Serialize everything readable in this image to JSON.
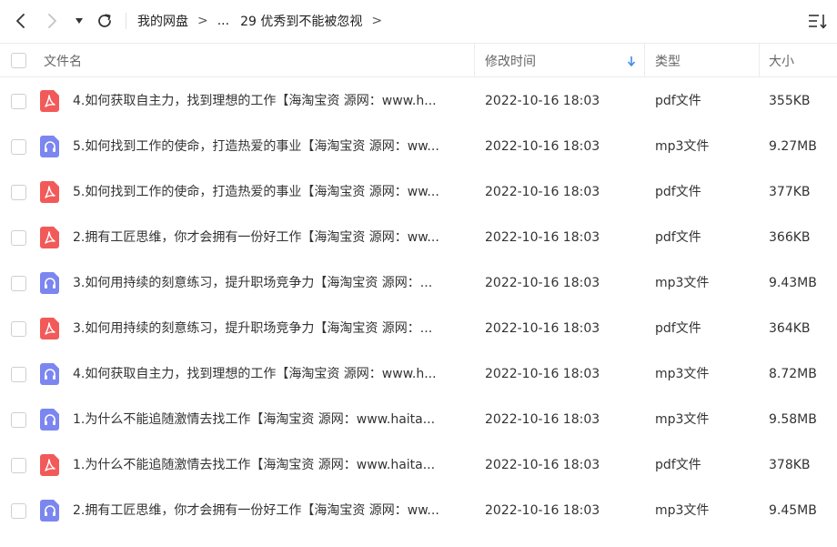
{
  "breadcrumb": {
    "root": "我的网盘",
    "ellipsis": "...",
    "current": "29 优秀到不能被忽视",
    "separator": ">"
  },
  "table": {
    "columns": {
      "name": "文件名",
      "modified": "修改时间",
      "type": "类型",
      "size": "大小"
    },
    "sorted_by": "修改时间",
    "sort_direction": "descending",
    "rows": [
      {
        "icon": "pdf-file-icon",
        "name": "4.如何获取自主力，找到理想的工作【海淘宝资 源网：www.h...",
        "modified": "2022-10-16 18:03",
        "type": "pdf文件",
        "size": "355KB"
      },
      {
        "icon": "mp3-file-icon",
        "name": "5.如何找到工作的使命，打造热爱的事业【海淘宝资 源网：ww...",
        "modified": "2022-10-16 18:03",
        "type": "mp3文件",
        "size": "9.27MB"
      },
      {
        "icon": "pdf-file-icon",
        "name": "5.如何找到工作的使命，打造热爱的事业【海淘宝资 源网：ww...",
        "modified": "2022-10-16 18:03",
        "type": "pdf文件",
        "size": "377KB"
      },
      {
        "icon": "pdf-file-icon",
        "name": "2.拥有工匠思维，你才会拥有一份好工作【海淘宝资 源网：ww...",
        "modified": "2022-10-16 18:03",
        "type": "pdf文件",
        "size": "366KB"
      },
      {
        "icon": "mp3-file-icon",
        "name": "3.如何用持续的刻意练习，提升职场竞争力【海淘宝资 源网：...",
        "modified": "2022-10-16 18:03",
        "type": "mp3文件",
        "size": "9.43MB"
      },
      {
        "icon": "pdf-file-icon",
        "name": "3.如何用持续的刻意练习，提升职场竞争力【海淘宝资 源网：...",
        "modified": "2022-10-16 18:03",
        "type": "pdf文件",
        "size": "364KB"
      },
      {
        "icon": "mp3-file-icon",
        "name": "4.如何获取自主力，找到理想的工作【海淘宝资 源网：www.h...",
        "modified": "2022-10-16 18:03",
        "type": "mp3文件",
        "size": "8.72MB"
      },
      {
        "icon": "mp3-file-icon",
        "name": "1.为什么不能追随激情去找工作【海淘宝资 源网：www.haita...",
        "modified": "2022-10-16 18:03",
        "type": "mp3文件",
        "size": "9.58MB"
      },
      {
        "icon": "pdf-file-icon",
        "name": "1.为什么不能追随激情去找工作【海淘宝资 源网：www.haita...",
        "modified": "2022-10-16 18:03",
        "type": "pdf文件",
        "size": "378KB"
      },
      {
        "icon": "mp3-file-icon",
        "name": "2.拥有工匠思维，你才会拥有一份好工作【海淘宝资 源网：ww...",
        "modified": "2022-10-16 18:03",
        "type": "mp3文件",
        "size": "9.45MB"
      }
    ]
  },
  "colors": {
    "pdf_icon": "#f25a5a",
    "mp3_icon": "#7b86f0",
    "sort_arrow": "#3f8ee8"
  }
}
